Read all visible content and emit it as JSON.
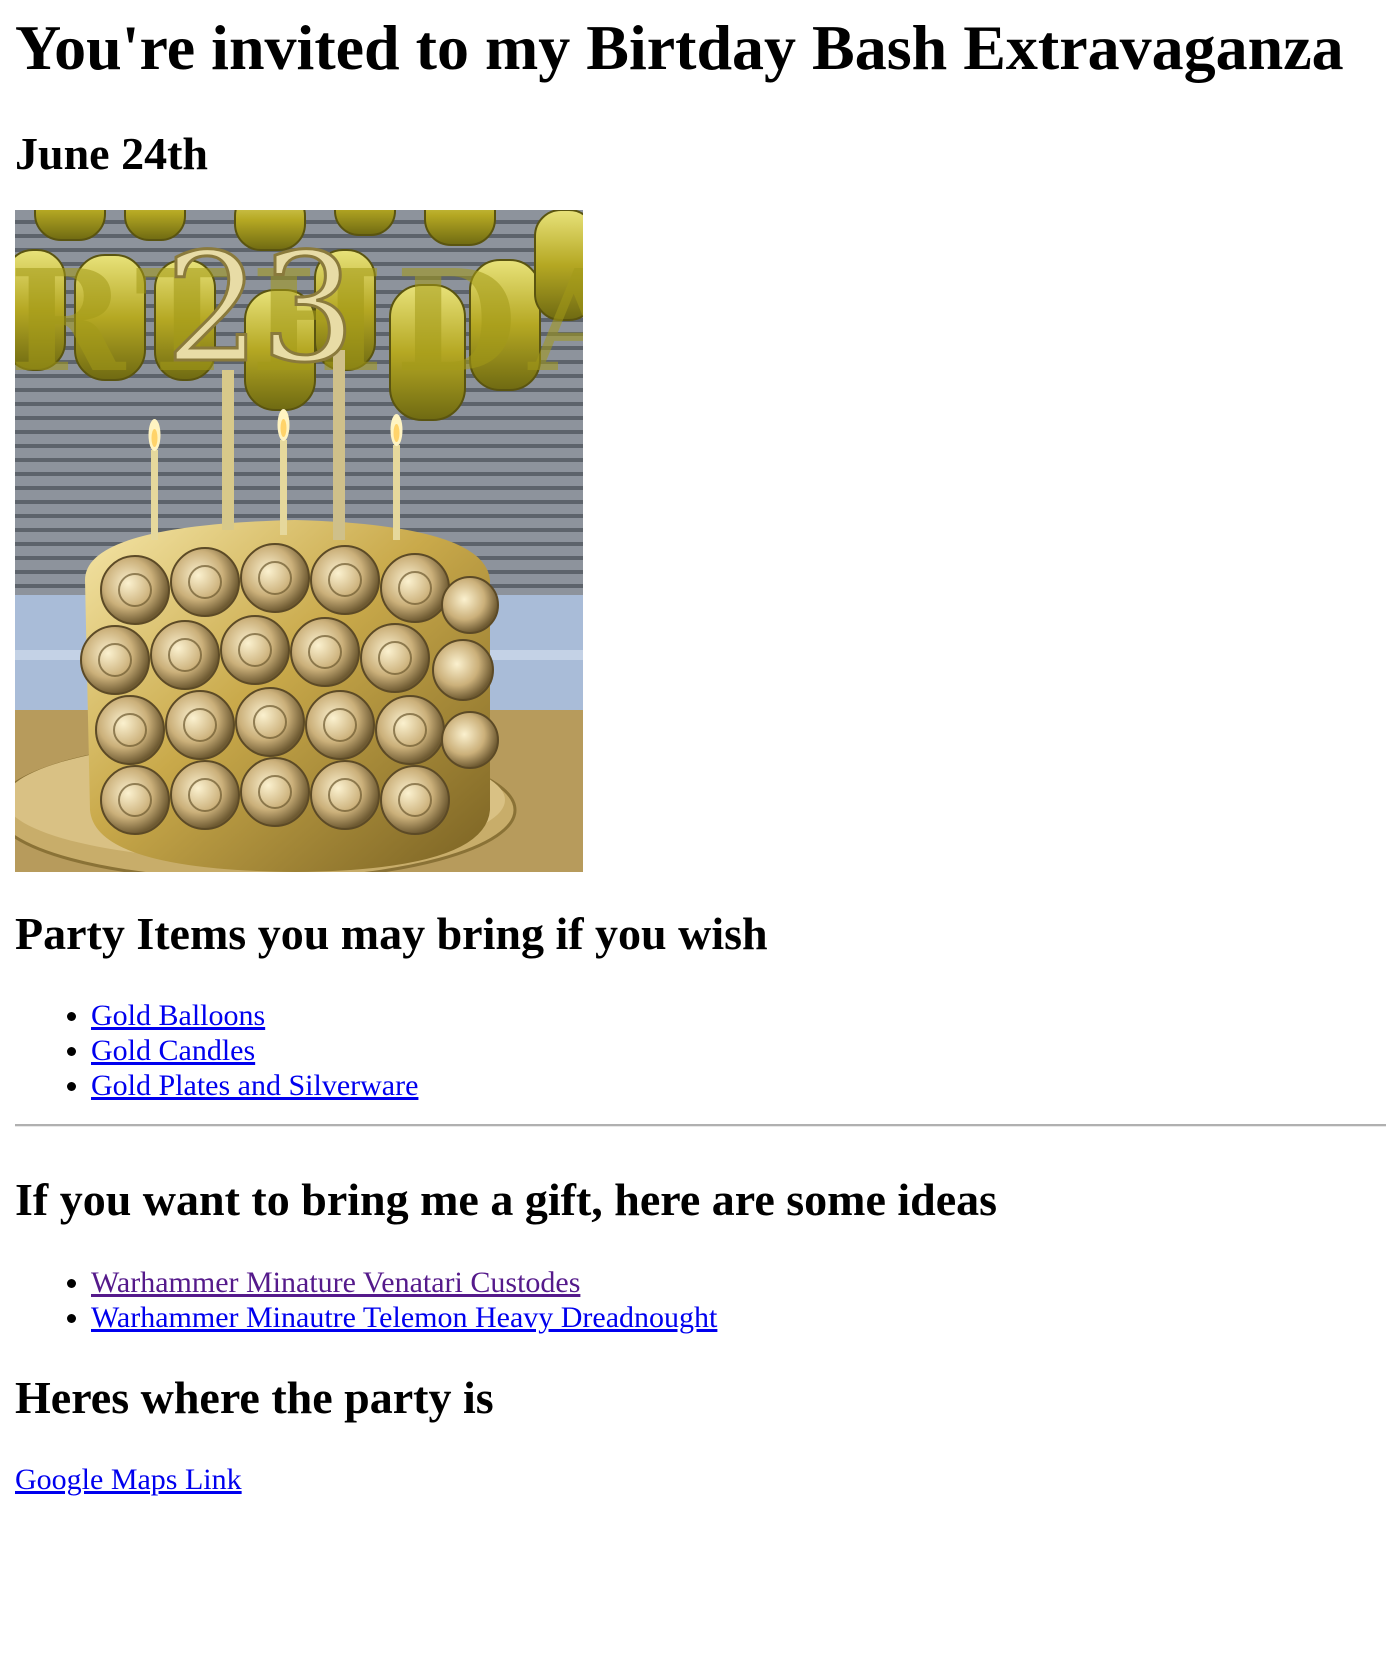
{
  "title": "You're invited to my Birtday Bash Extravaganza",
  "date": "June 24th",
  "image": {
    "balloon_letters": "RTHDA",
    "topper": "23"
  },
  "party_items": {
    "heading": "Party Items you may bring if you wish",
    "items": [
      "Gold Balloons",
      "Gold Candles",
      "Gold Plates and Silverware"
    ]
  },
  "gifts": {
    "heading": "If you want to bring me a gift, here are some ideas",
    "items": [
      "Warhammer Minature Venatari Custodes",
      "Warhammer Minautre Telemon Heavy Dreadnought"
    ]
  },
  "location": {
    "heading": "Heres where the party is",
    "link": "Google Maps Link"
  },
  "colors": {
    "link": "#0000ee",
    "visited_link": "#551a8b",
    "gold": "#c9a94a"
  }
}
